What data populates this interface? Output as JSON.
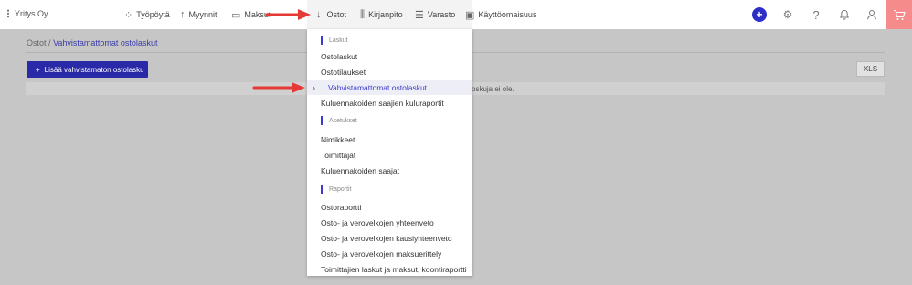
{
  "header": {
    "company": "Yritys Oy",
    "nav": [
      {
        "label": "Työpöytä",
        "icon": "dashboard-icon"
      },
      {
        "label": "Myynnit",
        "icon": "arrow-up-icon"
      },
      {
        "label": "Maksut",
        "icon": "payment-icon"
      },
      {
        "label": "Ostot",
        "icon": "arrow-down-icon"
      },
      {
        "label": "Kirjanpito",
        "icon": "bar-chart-icon"
      },
      {
        "label": "Varasto",
        "icon": "warehouse-icon"
      },
      {
        "label": "Käyttöomaisuus",
        "icon": "briefcase-icon"
      }
    ],
    "actions": [
      "plus-icon",
      "gear-icon",
      "help-icon",
      "bell-icon",
      "user-icon",
      "cart-icon"
    ]
  },
  "breadcrumb": {
    "parent": "Ostot",
    "separator": "/",
    "current": "Vahvistamattomat ostolaskut"
  },
  "toolbar": {
    "add_label": "Lisää vahvistamaton ostolasku",
    "add_icon": "+",
    "xls_label": "XLS"
  },
  "empty_text": "oskuja ei ole.",
  "dropdown": {
    "sections": [
      {
        "title": "Laskut",
        "items": [
          "Ostolaskut",
          "Ostotilaukset",
          "Vahvistamattomat ostolaskut",
          "Kuluennakoiden saajien kuluraportit"
        ]
      },
      {
        "title": "Asetukset",
        "items": [
          "Nimikkeet",
          "Toimittajat",
          "Kuluennakoiden saajat"
        ]
      },
      {
        "title": "Raportit",
        "items": [
          "Ostoraportti",
          "Osto- ja verovelkojen yhteenveto",
          "Osto- ja verovelkojen kausiyhteenveto",
          "Osto- ja verovelkojen maksuerittely",
          "Toimittajien laskut ja maksut, koontiraportti"
        ]
      }
    ],
    "active_item": "Vahvistamattomat ostolaskut"
  },
  "colors": {
    "accent": "#2a2aa8",
    "active_text": "#3b3bcf",
    "overlay": "#c6c6c6",
    "cart": "#f58b8b",
    "annotation_arrow": "#e53935"
  }
}
